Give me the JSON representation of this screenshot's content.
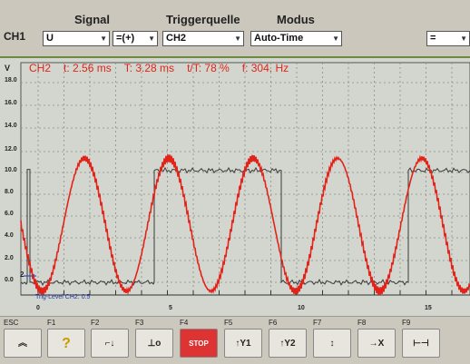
{
  "header": {
    "channel": "CH1",
    "col_signal": "Signal",
    "col_trigger": "Triggerquelle",
    "col_mode": "Modus",
    "signal_value": "U",
    "signal_op": "=(+)",
    "trigger_value": "CH2",
    "mode_value": "Auto-Time",
    "right_op": "="
  },
  "readout": {
    "channel": "CH2",
    "t": "t: 2.56 ms",
    "T": "T: 3.28 ms",
    "ratio": "t/T: 78 %",
    "f": "f: 304. Hz"
  },
  "axis": {
    "y_unit": "V",
    "y_ticks": [
      "18.0",
      "16.0",
      "14.0",
      "12.0",
      "10.0",
      "8.0",
      "6.0",
      "4.0",
      "2.0",
      "0.0"
    ],
    "x_ticks": [
      "0",
      "5",
      "10",
      "15"
    ],
    "trigger_marker": "2",
    "trig_level": "Trig-Level CH2: 0.5"
  },
  "fkeys": [
    {
      "label": "ESC",
      "icon": "chevrons-up-icon",
      "glyph": "︽"
    },
    {
      "label": "F1",
      "icon": "help-icon",
      "glyph": "?"
    },
    {
      "label": "F2",
      "icon": "trigger-edge-icon",
      "glyph": "⌐↓"
    },
    {
      "label": "F3",
      "icon": "trigger-position-icon",
      "glyph": "⊥o"
    },
    {
      "label": "F4",
      "icon": "stop-icon",
      "glyph": "STOP"
    },
    {
      "label": "F5",
      "icon": "cursor-y1-icon",
      "glyph": "↑Y1"
    },
    {
      "label": "F6",
      "icon": "cursor-y2-icon",
      "glyph": "↑Y2"
    },
    {
      "label": "F7",
      "icon": "trigger-level-icon",
      "glyph": "↕"
    },
    {
      "label": "F8",
      "icon": "time-cursor-icon",
      "glyph": "→X"
    },
    {
      "label": "F9",
      "icon": "measure-icon",
      "glyph": "⊢⊣"
    }
  ],
  "colors": {
    "ch2": "#e2231a",
    "ch1": "#3a3a3a",
    "grid": "#8a8e86"
  }
}
